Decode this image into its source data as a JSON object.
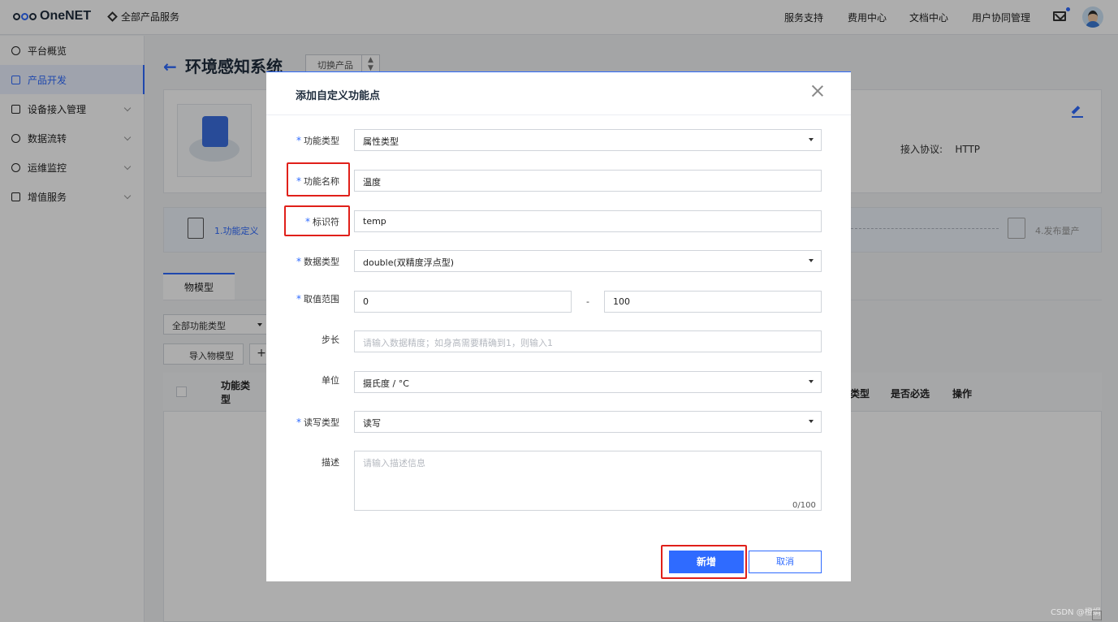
{
  "header": {
    "logo": "OneNET",
    "all_services": "全部产品服务",
    "nav": [
      "服务支持",
      "费用中心",
      "文档中心",
      "用户协同管理"
    ],
    "mail_icon": "mail-icon",
    "avatar_icon": "user-avatar"
  },
  "sidebar": {
    "items": [
      {
        "label": "平台概览",
        "icon": "overview-icon"
      },
      {
        "label": "产品开发",
        "icon": "cube-icon",
        "active": true
      },
      {
        "label": "设备接入管理",
        "icon": "device-icon"
      },
      {
        "label": "数据流转",
        "icon": "flow-icon"
      },
      {
        "label": "运维监控",
        "icon": "monitor-icon"
      },
      {
        "label": "增值服务",
        "icon": "service-icon"
      }
    ]
  },
  "product": {
    "title": "环境感知系统",
    "switch_label": "切换产品",
    "protocol_label": "接入协议:",
    "protocol_value": "HTTP"
  },
  "steps": {
    "step1": "1.功能定义",
    "step4": "4.发布量产"
  },
  "tabs": [
    "物模型"
  ],
  "toolbar": {
    "filter_value": "全部功能类型",
    "import_label": "导入物模型",
    "add_symbol": "+"
  },
  "table": {
    "headers": {
      "type": "功能类型",
      "data_type_partial": "类型",
      "required": "是否必选",
      "action": "操作"
    }
  },
  "modal": {
    "title": "添加自定义功能点",
    "fields": {
      "func_type": {
        "label": "功能类型",
        "value": "属性类型"
      },
      "func_name": {
        "label": "功能名称",
        "value": "温度"
      },
      "identifier": {
        "label": "标识符",
        "value": "temp"
      },
      "data_type": {
        "label": "数据类型",
        "value": "double(双精度浮点型)"
      },
      "range": {
        "label": "取值范围",
        "min": "0",
        "sep": "-",
        "max": "100"
      },
      "step": {
        "label": "步长",
        "placeholder": "请输入数据精度；如身高需要精确到1，则输入1"
      },
      "unit": {
        "label": "单位",
        "value": "摄氏度 / °C"
      },
      "rw_type": {
        "label": "读写类型",
        "value": "读写"
      },
      "desc": {
        "label": "描述",
        "placeholder": "请输入描述信息",
        "counter": "0/100"
      }
    },
    "required_mark": "*",
    "confirm_label": "新增",
    "cancel_label": "取消"
  },
  "watermark": "CSDN @橙蜩",
  "colors": {
    "accent": "#2f6bff",
    "highlight": "#e0201a"
  }
}
